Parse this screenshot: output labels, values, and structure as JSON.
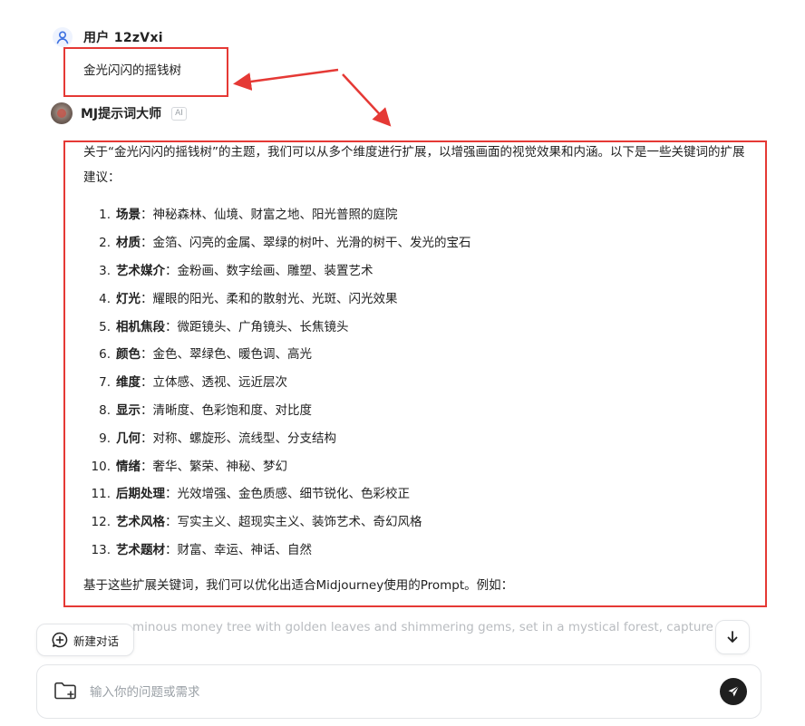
{
  "user": {
    "name": "用户 12zVxi",
    "message": "金光闪闪的摇钱树"
  },
  "bot": {
    "name": "MJ提示词大师",
    "badge": "AI",
    "intro": "关于“金光闪闪的摇钱树”的主题，我们可以从多个维度进行扩展，以增强画面的视觉效果和内涵。以下是一些关键词的扩展建议：",
    "keywords": [
      {
        "num": "1.",
        "term": "场景",
        "desc": "：神秘森林、仙境、财富之地、阳光普照的庭院"
      },
      {
        "num": "2.",
        "term": "材质",
        "desc": "：金箔、闪亮的金属、翠绿的树叶、光滑的树干、发光的宝石"
      },
      {
        "num": "3.",
        "term": "艺术媒介",
        "desc": "：金粉画、数字绘画、雕塑、装置艺术"
      },
      {
        "num": "4.",
        "term": "灯光",
        "desc": "：耀眼的阳光、柔和的散射光、光斑、闪光效果"
      },
      {
        "num": "5.",
        "term": "相机焦段",
        "desc": "：微距镜头、广角镜头、长焦镜头"
      },
      {
        "num": "6.",
        "term": "颜色",
        "desc": "：金色、翠绿色、暖色调、高光"
      },
      {
        "num": "7.",
        "term": "维度",
        "desc": "：立体感、透视、远近层次"
      },
      {
        "num": "8.",
        "term": "显示",
        "desc": "：清晰度、色彩饱和度、对比度"
      },
      {
        "num": "9.",
        "term": "几何",
        "desc": "：对称、螺旋形、流线型、分支结构"
      },
      {
        "num": "10.",
        "term": "情绪",
        "desc": "：奢华、繁荣、神秘、梦幻"
      },
      {
        "num": "11.",
        "term": "后期处理",
        "desc": "：光效增强、金色质感、细节锐化、色彩校正"
      },
      {
        "num": "12.",
        "term": "艺术风格",
        "desc": "：写实主义、超现实主义、装饰艺术、奇幻风格"
      },
      {
        "num": "13.",
        "term": "艺术题材",
        "desc": "：财富、幸运、神话、自然"
      }
    ],
    "footer": "基于这些扩展关键词，我们可以优化出适合Midjourney使用的Prompt。例如：",
    "faded_line": "minous money tree with golden leaves and shimmering gems, set in a mystical forest, captured in"
  },
  "controls": {
    "new_chat_label": "新建对话",
    "input_placeholder": "输入你的问题或需求"
  },
  "colors": {
    "highlight": "#e53935",
    "send_button": "#1f1f1f",
    "user_icon": "#3b6fe0"
  },
  "icons": {
    "user": "person-icon",
    "new_chat": "plus-chat-icon",
    "scroll_down": "arrow-down-icon",
    "attach": "folder-icon",
    "send": "send-icon"
  }
}
